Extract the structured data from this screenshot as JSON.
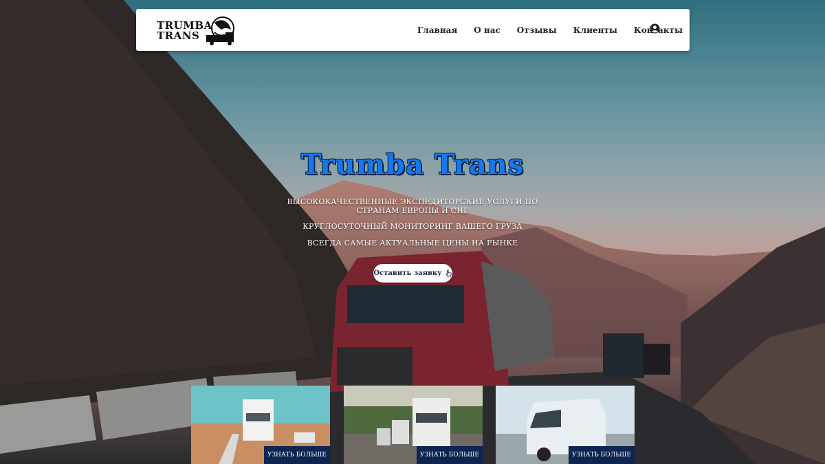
{
  "navbar": {
    "logo_line1": "TRUMBA",
    "logo_line2": "TRANS",
    "links": [
      "Главная",
      "О нас",
      "Отзывы",
      "Клиенты",
      "Контакты"
    ],
    "user_icon": "user-circle-icon"
  },
  "hero": {
    "title": "Trumba Trans",
    "line1": "Высококачественные экспедиторские услуги по странам Европы и СНГ",
    "line2": "Круглосуточный мониторинг вашего груза",
    "line3": "Всегда самые актуальные цены на рынке",
    "cta_label": "Оставить заявку",
    "cta_icon": "pointer-hand-icon"
  },
  "cards": [
    {
      "button": "Узнать больше"
    },
    {
      "button": "Узнать больше"
    },
    {
      "button": "Узнать больше"
    }
  ],
  "colors": {
    "title_blue": "#1479ef",
    "card_button": "#0d2550",
    "navbar_bg": "#ffffff"
  }
}
